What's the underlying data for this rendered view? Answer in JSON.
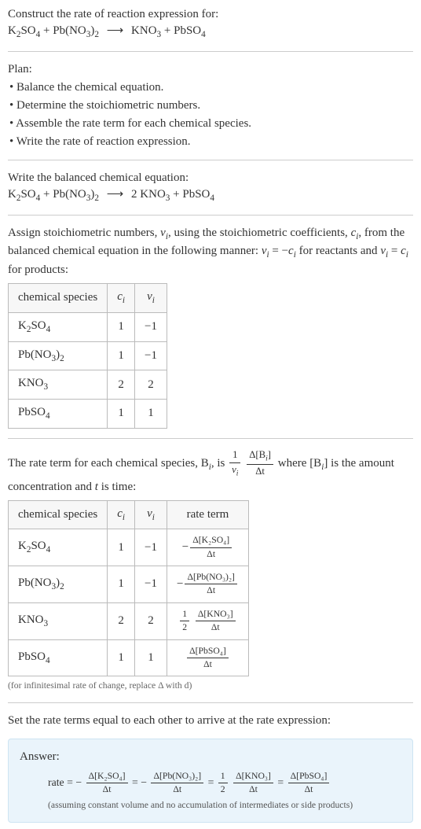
{
  "intro": {
    "prompt": "Construct the rate of reaction expression for:",
    "eq_lhs1": "K",
    "eq_lhs1_sub1": "2",
    "eq_lhs1_mid": "SO",
    "eq_lhs1_sub2": "4",
    "plus1": " + ",
    "eq_lhs2": "Pb(NO",
    "eq_lhs2_sub1": "3",
    "eq_lhs2_mid": ")",
    "eq_lhs2_sub2": "2",
    "arrow": "⟶",
    "eq_rhs1": "KNO",
    "eq_rhs1_sub": "3",
    "plus2": " + ",
    "eq_rhs2": "PbSO",
    "eq_rhs2_sub": "4"
  },
  "plan": {
    "title": "Plan:",
    "items": [
      "• Balance the chemical equation.",
      "• Determine the stoichiometric numbers.",
      "• Assemble the rate term for each chemical species.",
      "• Write the rate of reaction expression."
    ]
  },
  "balanced": {
    "title": "Write the balanced chemical equation:",
    "coef_kno3": "2 "
  },
  "assign": {
    "text1": "Assign stoichiometric numbers, ",
    "nu_i": "ν",
    "nu_i_sub": "i",
    "text2": ", using the stoichiometric coefficients, ",
    "c_i": "c",
    "c_i_sub": "i",
    "text3": ", from the balanced chemical equation in the following manner: ",
    "rel_react": " = −",
    "text4": " for reactants and ",
    "rel_prod": " = ",
    "text5": " for products:"
  },
  "table1": {
    "h1": "chemical species",
    "h2": "c",
    "h2s": "i",
    "h3": "ν",
    "h3s": "i",
    "rows": [
      {
        "sp_a": "K",
        "sp_as": "2",
        "sp_b": "SO",
        "sp_bs": "4",
        "c": "1",
        "nu": "−1"
      },
      {
        "sp_a": "Pb(NO",
        "sp_as": "3",
        "sp_b": ")",
        "sp_bs": "2",
        "c": "1",
        "nu": "−1"
      },
      {
        "sp_a": "KNO",
        "sp_as": "3",
        "sp_b": "",
        "sp_bs": "",
        "c": "2",
        "nu": "2"
      },
      {
        "sp_a": "PbSO",
        "sp_as": "4",
        "sp_b": "",
        "sp_bs": "",
        "c": "1",
        "nu": "1"
      }
    ]
  },
  "rateterm": {
    "t1": "The rate term for each chemical species, B",
    "t1s": "i",
    "t2": ", is ",
    "one": "1",
    "nu": "ν",
    "nus": "i",
    "dB_num": "Δ[B",
    "dB_nums": "i",
    "dB_numend": "]",
    "dB_den": "Δt",
    "t3": " where [B",
    "t3s": "i",
    "t4": "] is the amount concentration and ",
    "tvar": "t",
    "t5": " is time:"
  },
  "table2": {
    "h1": "chemical species",
    "h2": "c",
    "h2s": "i",
    "h3": "ν",
    "h3s": "i",
    "h4": "rate term",
    "rows": [
      {
        "sp_a": "K",
        "sp_as": "2",
        "sp_b": "SO",
        "sp_bs": "4",
        "c": "1",
        "nu": "−1",
        "pre": "−",
        "half": "",
        "num": "Δ[K₂SO₄]",
        "den": "Δt"
      },
      {
        "sp_a": "Pb(NO",
        "sp_as": "3",
        "sp_b": ")",
        "sp_bs": "2",
        "c": "1",
        "nu": "−1",
        "pre": "−",
        "half": "",
        "num": "Δ[Pb(NO₃)₂]",
        "den": "Δt"
      },
      {
        "sp_a": "KNO",
        "sp_as": "3",
        "sp_b": "",
        "sp_bs": "",
        "c": "2",
        "nu": "2",
        "pre": "",
        "half": "½",
        "num": "Δ[KNO₃]",
        "den": "Δt"
      },
      {
        "sp_a": "PbSO",
        "sp_as": "4",
        "sp_b": "",
        "sp_bs": "",
        "c": "1",
        "nu": "1",
        "pre": "",
        "half": "",
        "num": "Δ[PbSO₄]",
        "den": "Δt"
      }
    ],
    "note": "(for infinitesimal rate of change, replace Δ with d)"
  },
  "setequal": "Set the rate terms equal to each other to arrive at the rate expression:",
  "answer": {
    "label": "Answer:",
    "rate": "rate = ",
    "neg": "− ",
    "f1num": "Δ[K₂SO₄]",
    "f1den": "Δt",
    "eq": " = ",
    "f2num": "Δ[Pb(NO₃)₂]",
    "f2den": "Δt",
    "half_n": "1",
    "half_d": "2",
    "f3num": "Δ[KNO₃]",
    "f3den": "Δt",
    "f4num": "Δ[PbSO₄]",
    "f4den": "Δt",
    "subnote": "(assuming constant volume and no accumulation of intermediates or side products)"
  }
}
